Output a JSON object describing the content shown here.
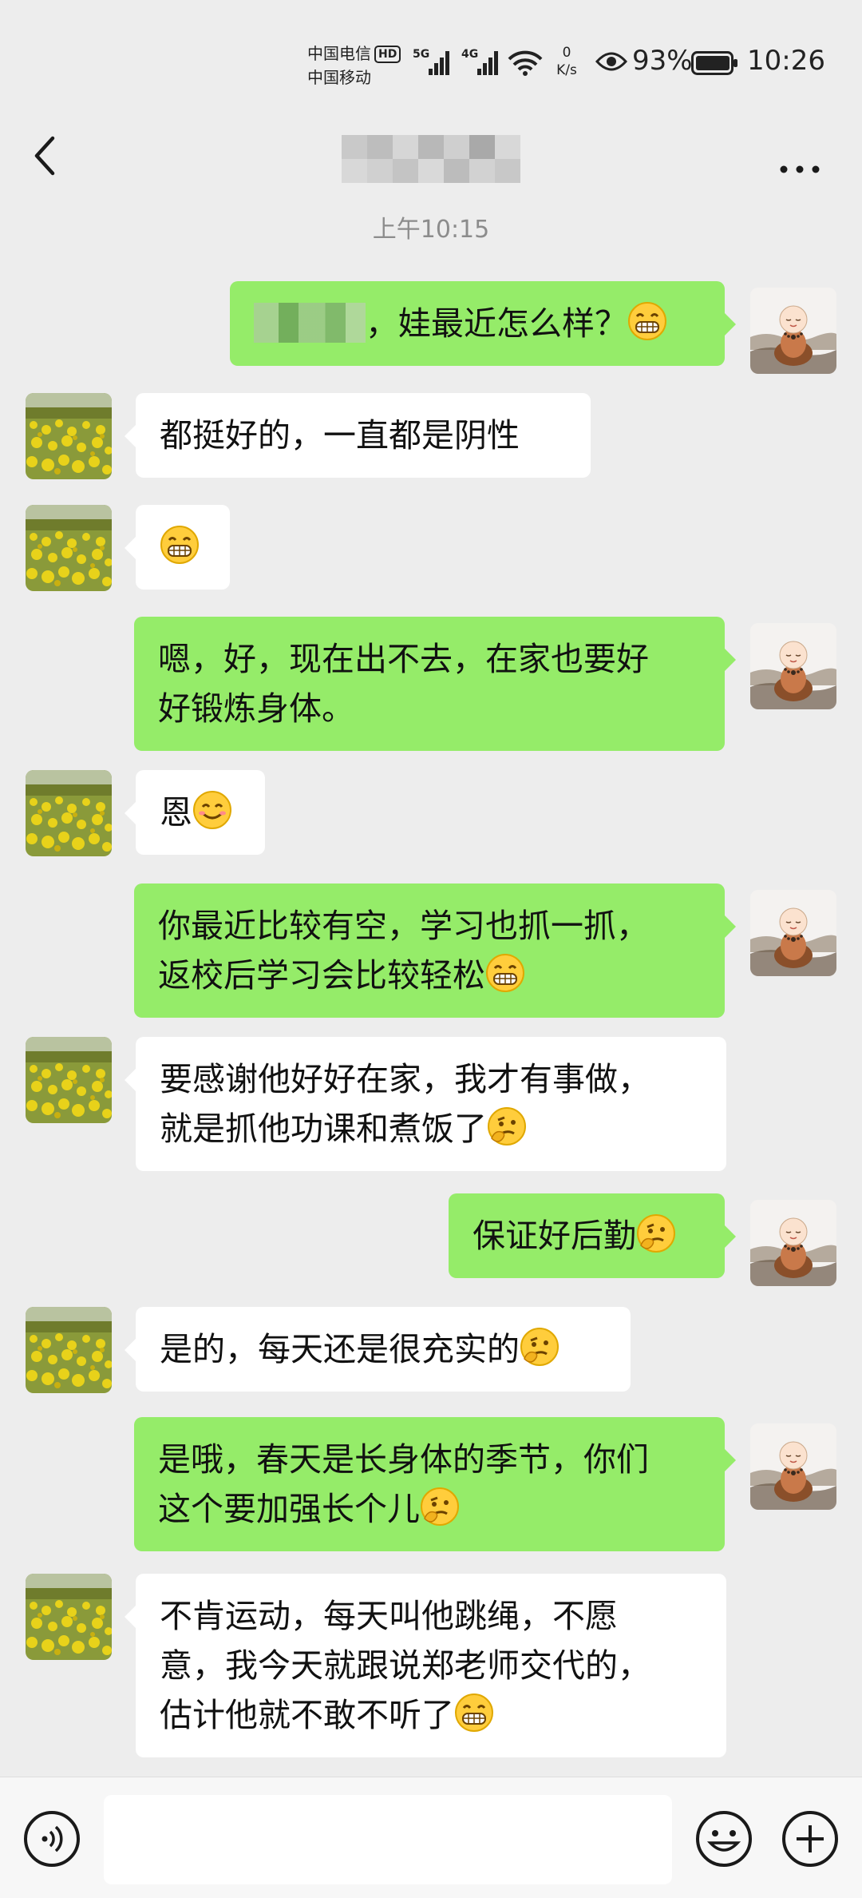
{
  "status_bar": {
    "carrier1": "中国电信",
    "carrier1_badge": "HD",
    "carrier2": "中国移动",
    "signal1_label": "5G",
    "signal2_label": "4G",
    "net_speed_value": "0",
    "net_speed_unit": "K/s",
    "battery_percent": "93%",
    "time": "10:26"
  },
  "header": {
    "title": "",
    "back_icon": "chevron-left-icon",
    "more_icon": "more-dots-icon"
  },
  "chat": {
    "timestamp": "上午10:15",
    "messages": [
      {
        "from": "self",
        "text": "，娃最近怎么样？",
        "emoji": "grin",
        "redacted_prefix": true
      },
      {
        "from": "other",
        "text": "都挺好的，一直都是阴性"
      },
      {
        "from": "other",
        "text": "",
        "emoji": "grin"
      },
      {
        "from": "self",
        "text": "嗯，好，现在出不去，在家也要好\n好锻炼身体。"
      },
      {
        "from": "other",
        "text": "恩",
        "emoji": "smile"
      },
      {
        "from": "self",
        "text": "你最近比较有空，学习也抓一抓，\n返校后学习会比较轻松",
        "emoji": "grin"
      },
      {
        "from": "other",
        "text": "要感谢他好好在家，我才有事做，\n就是抓他功课和煮饭了",
        "emoji": "thinking"
      },
      {
        "from": "self",
        "text": "保证好后勤",
        "emoji": "thinking"
      },
      {
        "from": "other",
        "text": "是的，每天还是很充实的",
        "emoji": "thinking"
      },
      {
        "from": "self",
        "text": "是哦，春天是长身体的季节，你们\n这个要加强长个儿",
        "emoji": "thinking"
      },
      {
        "from": "other",
        "text": "不肯运动，每天叫他跳绳，不愿\n意，我今天就跟说郑老师交代的，\n估计他就不敢不听了",
        "emoji": "grin"
      }
    ]
  },
  "input_bar": {
    "voice_icon": "voice-icon",
    "input_value": "",
    "emoji_icon": "emoji-icon",
    "plus_icon": "plus-icon"
  },
  "colors": {
    "background": "#ededed",
    "self_bubble": "#95ec69",
    "other_bubble": "#ffffff",
    "timestamp": "#8c8c8c"
  }
}
